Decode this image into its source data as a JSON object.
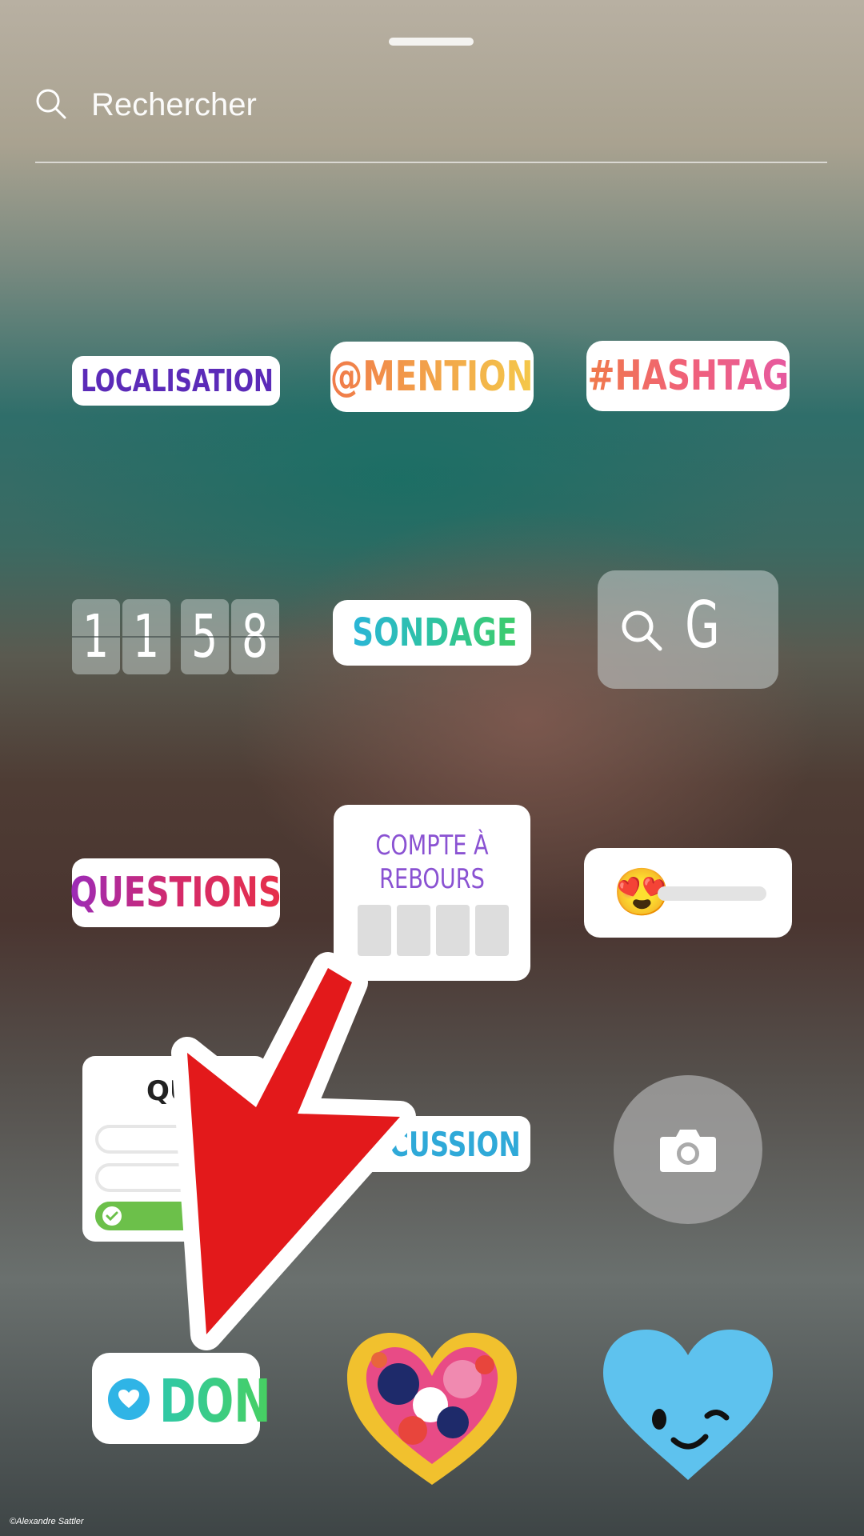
{
  "search": {
    "placeholder": "Rechercher"
  },
  "stickers": {
    "location": "LOCALISATION",
    "mention": "@MENTION",
    "hashtag": "#HASHTAG",
    "time_digits": [
      "1",
      "1",
      "5",
      "8"
    ],
    "poll": "SONDAGE",
    "gif_search": "G",
    "questions": "QUESTIONS",
    "countdown_title": "COMPTE À REBOURS",
    "slider_emoji": "😍",
    "quiz_title": "QU",
    "chat": "DISCUSSION",
    "donate": "DON"
  },
  "annotation": {
    "arrow_color": "#e3191b"
  },
  "credit": "©Alexandre Sattler",
  "colors": {
    "location": "#5b2bb8",
    "chat": "#2fa9d8",
    "donate_heart": "#2fb4e6",
    "wink_heart": "#5ec2ee"
  }
}
